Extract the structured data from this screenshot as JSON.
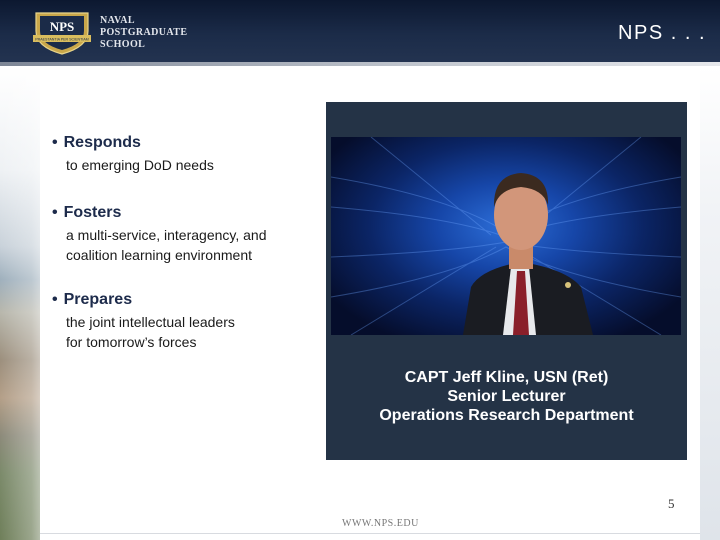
{
  "header": {
    "logo_text": "NPS",
    "logo_banner": "PRAESTANTIA PER SCIENTIAM",
    "school_name": [
      "NAVAL",
      "POSTGRADUATE",
      "SCHOOL"
    ],
    "title": "NPS . . ."
  },
  "bullets": [
    {
      "head": "Responds",
      "body": [
        "to emerging DoD needs"
      ]
    },
    {
      "head": "Fosters",
      "body": [
        "a multi-service, interagency, and",
        "coalition learning environment"
      ]
    },
    {
      "head": "Prepares",
      "body": [
        "the joint intellectual leaders",
        "for tomorrow’s forces"
      ]
    }
  ],
  "bullet_glyph": "•",
  "video": {
    "caption": [
      "CAPT Jeff Kline, USN (Ret)",
      "Senior Lecturer",
      "Operations Research Department"
    ]
  },
  "page_number": "5",
  "footer_url": "WWW.NPS.EDU",
  "colors": {
    "header_bg": "#1b2b48",
    "panel_bg": "#243346",
    "bullet_head": "#1d2b4b"
  }
}
